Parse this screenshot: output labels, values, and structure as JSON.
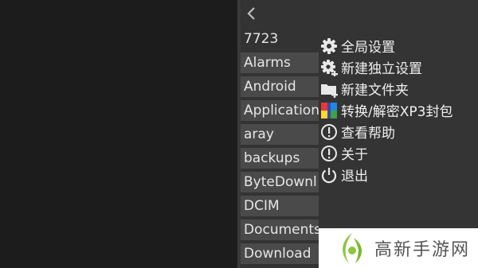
{
  "file_browser": {
    "items": [
      {
        "label": "7723"
      },
      {
        "label": "Alarms"
      },
      {
        "label": "Android"
      },
      {
        "label": "Application"
      },
      {
        "label": "aray"
      },
      {
        "label": "backups"
      },
      {
        "label": "ByteDownl"
      },
      {
        "label": "DCIM"
      },
      {
        "label": "Documents"
      },
      {
        "label": "Download"
      }
    ]
  },
  "menu": {
    "items": [
      {
        "label": "全局设置",
        "icon": "gear-icon"
      },
      {
        "label": "新建独立设置",
        "icon": "gear-add-icon"
      },
      {
        "label": "新建文件夹",
        "icon": "new-folder-icon"
      },
      {
        "label": "转换/解密XP3封包",
        "icon": "package-icon"
      },
      {
        "label": "查看帮助",
        "icon": "alert-circle-icon"
      },
      {
        "label": "关于",
        "icon": "info-circle-icon"
      },
      {
        "label": "退出",
        "icon": "power-icon"
      }
    ]
  },
  "watermark": {
    "text": "高新手游网"
  },
  "colors": {
    "accent_green": "#8dc63f",
    "menu_text": "#f0f0f0"
  }
}
